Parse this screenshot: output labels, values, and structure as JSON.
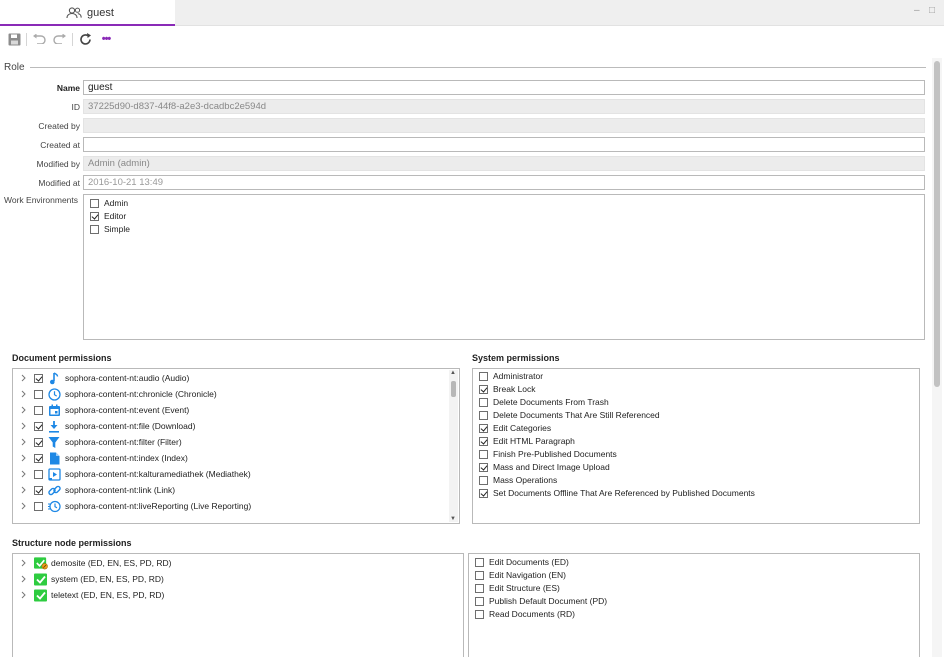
{
  "tab": {
    "label": "guest",
    "icon": "users-icon"
  },
  "window": {
    "minimize": "–",
    "maximize": "□"
  },
  "toolbar": {
    "buttons": [
      "save-icon",
      "undo-icon",
      "redo-icon",
      "refresh-icon",
      "more-icon"
    ],
    "more_label": "•••"
  },
  "section": {
    "title": "Role"
  },
  "fields": {
    "name": {
      "label": "Name",
      "value": "guest"
    },
    "id": {
      "label": "ID",
      "value": "37225d90-d837-44f8-a2e3-dcadbc2e594d"
    },
    "created_by": {
      "label": "Created by",
      "value": ""
    },
    "created_at": {
      "label": "Created at",
      "value": ""
    },
    "modified_by": {
      "label": "Modified by",
      "value": "Admin (admin)"
    },
    "modified_at": {
      "label": "Modified at",
      "value": "2016-10-21 13:49"
    },
    "work_env": {
      "label": "Work Environments",
      "items": [
        {
          "label": "Admin",
          "checked": false
        },
        {
          "label": "Editor",
          "checked": true
        },
        {
          "label": "Simple",
          "checked": false
        }
      ]
    }
  },
  "document_permissions": {
    "title": "Document permissions",
    "items": [
      {
        "label": "sophora-content-nt:audio (Audio)",
        "checked": true,
        "icon": "music-note-icon"
      },
      {
        "label": "sophora-content-nt:chronicle (Chronicle)",
        "checked": false,
        "icon": "clock-icon"
      },
      {
        "label": "sophora-content-nt:event (Event)",
        "checked": false,
        "icon": "calendar-icon"
      },
      {
        "label": "sophora-content-nt:file (Download)",
        "checked": true,
        "icon": "download-icon"
      },
      {
        "label": "sophora-content-nt:filter (Filter)",
        "checked": true,
        "icon": "filter-icon"
      },
      {
        "label": "sophora-content-nt:index (Index)",
        "checked": true,
        "icon": "document-icon"
      },
      {
        "label": "sophora-content-nt:kalturamediathek (Mediathek)",
        "checked": false,
        "icon": "media-icon"
      },
      {
        "label": "sophora-content-nt:link (Link)",
        "checked": true,
        "icon": "link-icon"
      },
      {
        "label": "sophora-content-nt:liveReporting (Live Reporting)",
        "checked": false,
        "icon": "live-clock-icon"
      }
    ]
  },
  "system_permissions": {
    "title": "System permissions",
    "items": [
      {
        "label": "Administrator",
        "checked": false
      },
      {
        "label": "Break Lock",
        "checked": true
      },
      {
        "label": "Delete Documents From Trash",
        "checked": false
      },
      {
        "label": "Delete Documents That Are Still Referenced",
        "checked": false
      },
      {
        "label": "Edit Categories",
        "checked": true
      },
      {
        "label": "Edit HTML Paragraph",
        "checked": true
      },
      {
        "label": "Finish Pre-Published Documents",
        "checked": false
      },
      {
        "label": "Mass and Direct Image Upload",
        "checked": true
      },
      {
        "label": "Mass Operations",
        "checked": false
      },
      {
        "label": "Set Documents Offline That Are Referenced by Published Documents",
        "checked": true
      }
    ]
  },
  "structure_node_permissions": {
    "title": "Structure node permissions",
    "nodes": [
      {
        "label": "demosite (ED, EN, ES, PD, RD)",
        "icon": "check-key-icon"
      },
      {
        "label": "system (ED, EN, ES, PD, RD)",
        "icon": "check-icon"
      },
      {
        "label": "teletext (ED, EN, ES, PD, RD)",
        "icon": "check-icon"
      }
    ],
    "rights": [
      {
        "label": "Edit Documents (ED)",
        "checked": false
      },
      {
        "label": "Edit Navigation (EN)",
        "checked": false
      },
      {
        "label": "Edit Structure (ES)",
        "checked": false
      },
      {
        "label": "Publish Default Document (PD)",
        "checked": false
      },
      {
        "label": "Read Documents (RD)",
        "checked": false
      }
    ]
  },
  "colors": {
    "accent": "#8a2ab7",
    "icon_blue": "#1e88e5",
    "icon_green": "#2ecc40",
    "badge_orange": "#f0a020"
  }
}
